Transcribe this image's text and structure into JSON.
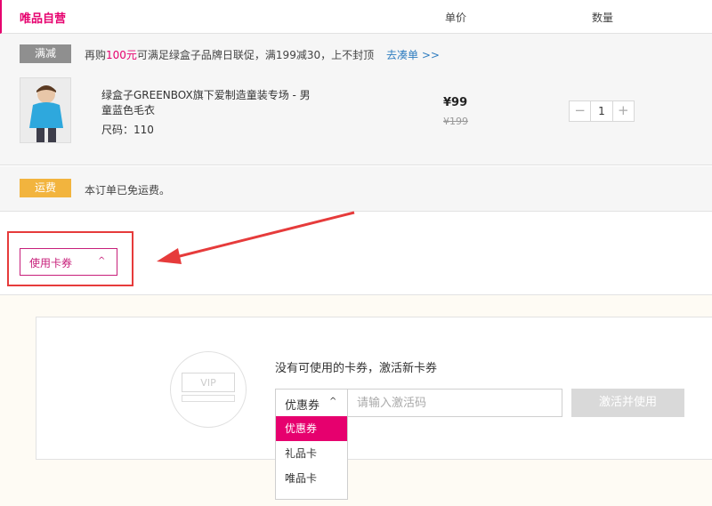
{
  "header": {
    "title": "唯品自营",
    "col_price": "单价",
    "col_qty": "数量"
  },
  "promo": {
    "tag": "满减",
    "text_before": "再购",
    "text_highlight": "100元",
    "text_after": "可满足绿盒子品牌日联促，满199减30，上不封顶",
    "link": "去凑单 >>"
  },
  "product": {
    "name": "绿盒子GREENBOX旗下爱制造童装专场 - 男童蓝色毛衣",
    "size_label": "尺码：110",
    "price": "¥99",
    "original_price": "¥199",
    "quantity": "1",
    "minus": "−",
    "plus": "+"
  },
  "shipping": {
    "tag": "运费",
    "text": "本订单已免运费。"
  },
  "coupon": {
    "toggle_label": "使用卡券",
    "toggle_chevron": "^",
    "vip_text": "VIP",
    "empty_text": "没有可使用的卡券，激活新卡券",
    "select_value": "优惠券",
    "select_chevron": "^",
    "code_placeholder": "请输入激活码",
    "activate_label": "激活并使用",
    "options": [
      "优惠券",
      "礼品卡",
      "唯品卡"
    ]
  },
  "colors": {
    "brand": "#e6006e",
    "annotation_red": "#e63b3b"
  }
}
